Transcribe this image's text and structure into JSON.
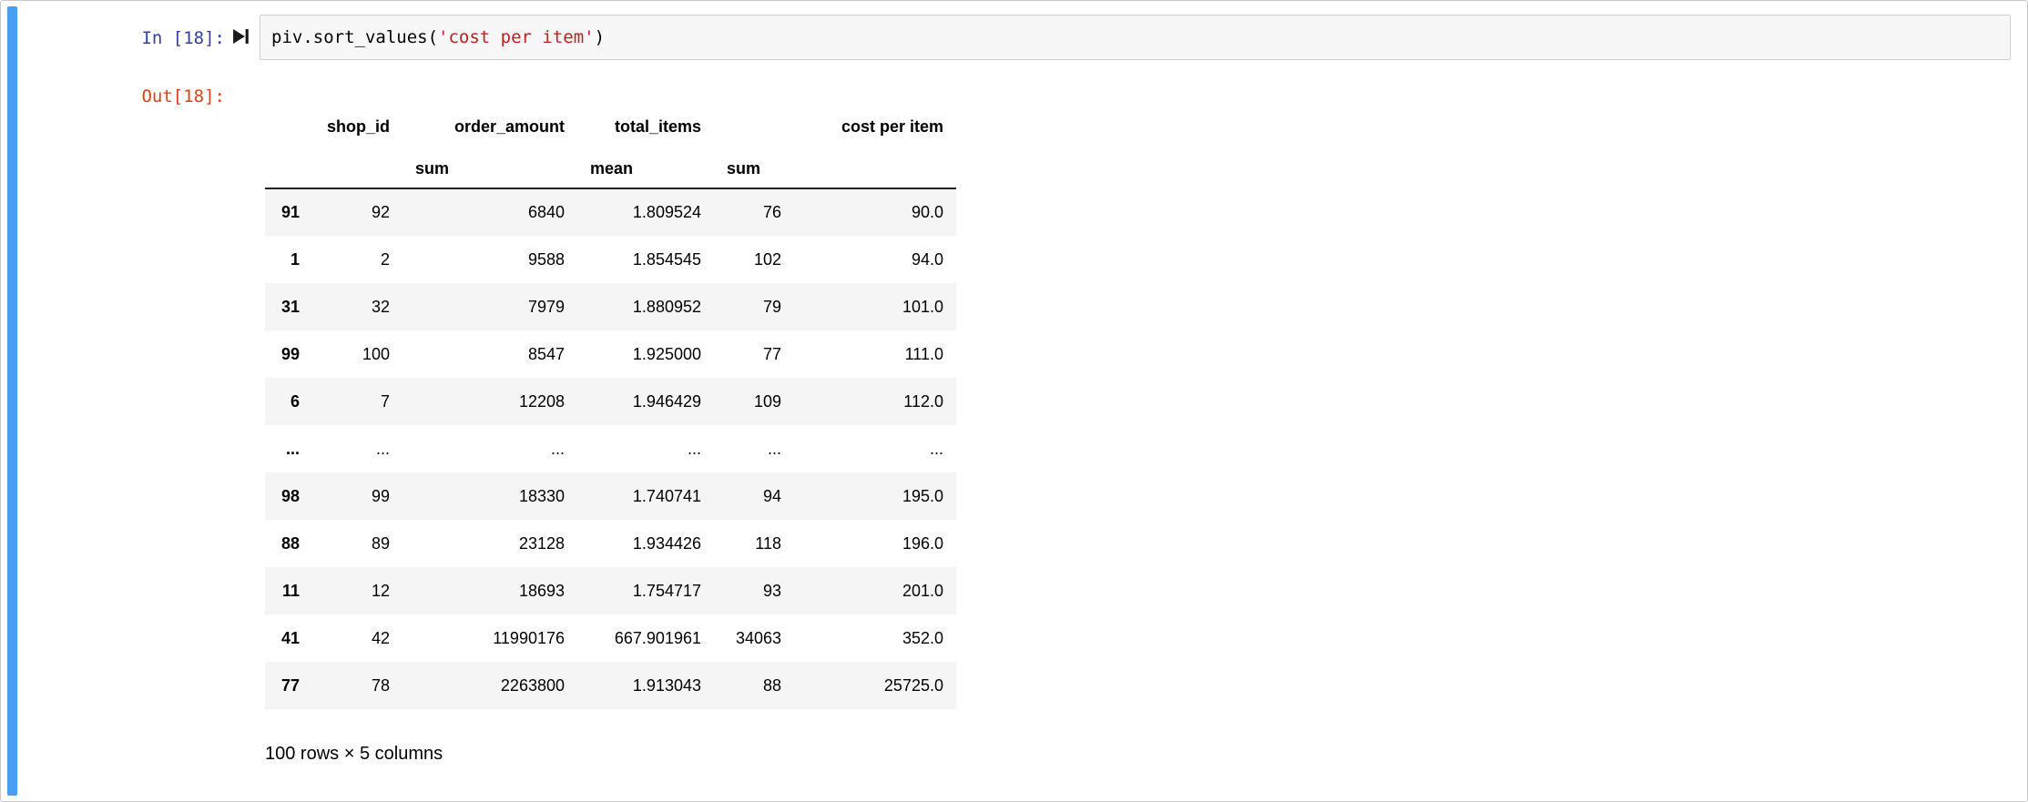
{
  "notebook": {
    "input_prompt": "In [18]:",
    "output_prompt": "Out[18]:",
    "code": {
      "pre": "piv.sort_values(",
      "string": "'cost per item'",
      "post": ")"
    }
  },
  "table": {
    "columns_level1": [
      "shop_id",
      "order_amount",
      "total_items",
      "",
      "cost per item"
    ],
    "columns_level2": [
      "",
      "sum",
      "mean",
      "sum",
      ""
    ],
    "rows": [
      {
        "index": "91",
        "values": [
          "92",
          "6840",
          "1.809524",
          "76",
          "90.0"
        ]
      },
      {
        "index": "1",
        "values": [
          "2",
          "9588",
          "1.854545",
          "102",
          "94.0"
        ]
      },
      {
        "index": "31",
        "values": [
          "32",
          "7979",
          "1.880952",
          "79",
          "101.0"
        ]
      },
      {
        "index": "99",
        "values": [
          "100",
          "8547",
          "1.925000",
          "77",
          "111.0"
        ]
      },
      {
        "index": "6",
        "values": [
          "7",
          "12208",
          "1.946429",
          "109",
          "112.0"
        ]
      },
      {
        "index": "...",
        "values": [
          "...",
          "...",
          "...",
          "...",
          "..."
        ]
      },
      {
        "index": "98",
        "values": [
          "99",
          "18330",
          "1.740741",
          "94",
          "195.0"
        ]
      },
      {
        "index": "88",
        "values": [
          "89",
          "23128",
          "1.934426",
          "118",
          "196.0"
        ]
      },
      {
        "index": "11",
        "values": [
          "12",
          "18693",
          "1.754717",
          "93",
          "201.0"
        ]
      },
      {
        "index": "41",
        "values": [
          "42",
          "11990176",
          "667.901961",
          "34063",
          "352.0"
        ]
      },
      {
        "index": "77",
        "values": [
          "78",
          "2263800",
          "1.913043",
          "88",
          "25725.0"
        ]
      }
    ],
    "shape_text": "100 rows × 5 columns"
  },
  "colors": {
    "selected_cell_bar": "#4a9ef0",
    "input_prompt": "#303f9f",
    "output_prompt": "#d84315",
    "code_string": "#ba2121",
    "row_stripe": "#f5f5f5",
    "code_box_bg": "#f7f7f7",
    "code_box_border": "#cfcfcf"
  },
  "icons": {
    "run_indicator": "run-to-end-icon"
  }
}
